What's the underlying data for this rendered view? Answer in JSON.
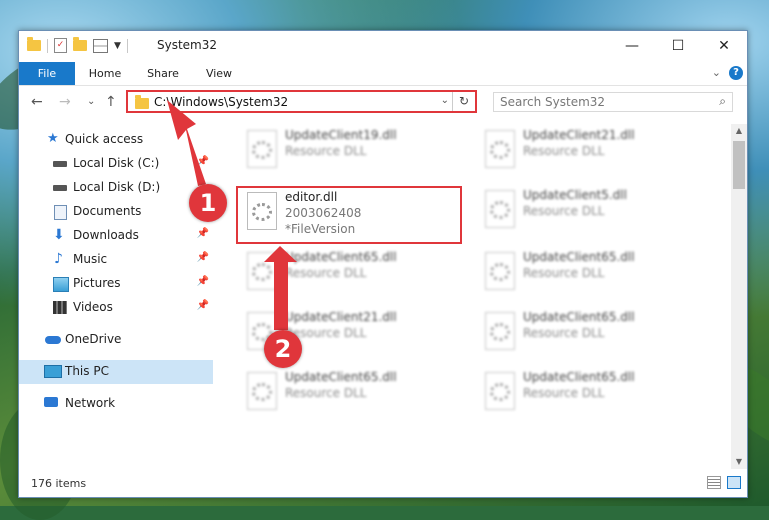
{
  "window": {
    "title": "System32",
    "minimize": "—",
    "maximize": "☐",
    "close": "✕"
  },
  "ribbon": {
    "file": "File",
    "home": "Home",
    "share": "Share",
    "view": "View",
    "collapse": "⌄",
    "help": "?"
  },
  "address": {
    "path": "C:\\Windows\\System32",
    "refresh": "↻",
    "dropdown": "⌄"
  },
  "search": {
    "placeholder": "Search System32",
    "icon": "⌕"
  },
  "nav_buttons": {
    "back": "←",
    "forward": "→",
    "recent": "⌄",
    "up": "↑"
  },
  "sidebar": {
    "items": [
      {
        "label": "Quick access",
        "icon": "star-icon",
        "color": "#2b78d3"
      },
      {
        "label": "Local Disk (C:)",
        "icon": "drive-icon",
        "color": "#555555"
      },
      {
        "label": "Local Disk (D:)",
        "icon": "drive-icon",
        "color": "#555555"
      },
      {
        "label": "Documents",
        "icon": "documents-icon",
        "color": "#6f8fb5"
      },
      {
        "label": "Downloads",
        "icon": "downloads-icon",
        "color": "#2b78d3"
      },
      {
        "label": "Music",
        "icon": "music-icon",
        "color": "#2b78d3"
      },
      {
        "label": "Pictures",
        "icon": "pictures-icon",
        "color": "#3a9fd6"
      },
      {
        "label": "Videos",
        "icon": "videos-icon",
        "color": "#333333"
      },
      {
        "label": "OneDrive",
        "icon": "cloud-icon",
        "color": "#2b78d3"
      },
      {
        "label": "This PC",
        "icon": "computer-icon",
        "color": "#3a9fd6"
      },
      {
        "label": "Network",
        "icon": "network-icon",
        "color": "#2b78d3"
      }
    ]
  },
  "files": [
    {
      "name": "UpdateClient19.dll",
      "type": "Resource DLL"
    },
    {
      "name": "UpdateClient21.dll",
      "type": "Resource DLL"
    },
    {
      "name": "editor.dll",
      "version": "2003062408",
      "type": "*FileVersion"
    },
    {
      "name": "UpdateClient5.dll",
      "type": "Resource DLL"
    },
    {
      "name": "UpdateClient65.dll",
      "type": "Resource DLL"
    },
    {
      "name": "UpdateClient65.dll",
      "type": "Resource DLL"
    },
    {
      "name": "UpdateClient21.dll",
      "type": "Resource DLL"
    },
    {
      "name": "UpdateClient65.dll",
      "type": "Resource DLL"
    },
    {
      "name": "UpdateClient65.dll",
      "type": "Resource DLL"
    },
    {
      "name": "UpdateClient65.dll",
      "type": "Resource DLL"
    }
  ],
  "status": {
    "count": "176 items"
  },
  "callouts": {
    "one": "1",
    "two": "2"
  },
  "colors": {
    "accent": "#1979ca",
    "highlight": "#e0363b"
  }
}
